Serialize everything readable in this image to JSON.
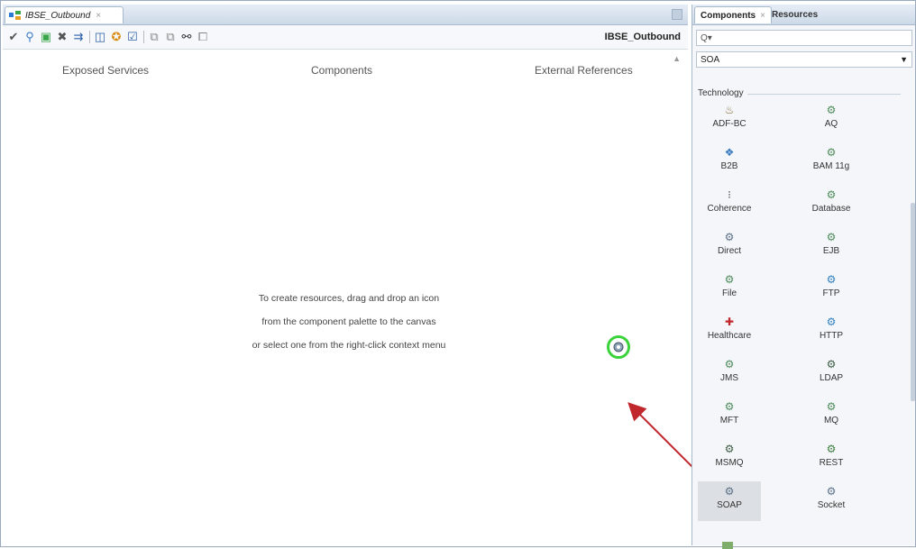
{
  "editor": {
    "tab_title": "IBSE_Outbound",
    "tab_close": "×",
    "composite_name": "IBSE_Outbound",
    "toolbar_icons": [
      "validate-icon",
      "wire-icon",
      "image-icon",
      "delete-icon",
      "deploy-icon",
      "test-icon",
      "bug-icon",
      "check-icon",
      "copy-icon",
      "paste-icon",
      "find-icon",
      "duplicate-icon"
    ]
  },
  "canvas": {
    "col_exposed": "Exposed Services",
    "col_components": "Components",
    "col_external": "External References",
    "hint_line1": "To create resources, drag and drop an icon",
    "hint_line2": "from the component palette to the canvas",
    "hint_line3": "or select one from the right-click context menu"
  },
  "palette": {
    "tab_components": "Components",
    "tab_resources": "Resources",
    "search_prefix": "Q▾",
    "category_selected": "SOA",
    "group_label": "Technology",
    "items": [
      {
        "label": "ADF-BC",
        "icon": "adf-bc-icon",
        "glyph": "♨"
      },
      {
        "label": "AQ",
        "icon": "aq-icon",
        "glyph": "⚙"
      },
      {
        "label": "B2B",
        "icon": "b2b-icon",
        "glyph": "❖"
      },
      {
        "label": "BAM 11g",
        "icon": "bam-icon",
        "glyph": "⚙"
      },
      {
        "label": "Coherence",
        "icon": "coherence-icon",
        "glyph": "⁝"
      },
      {
        "label": "Database",
        "icon": "database-icon",
        "glyph": "⚙"
      },
      {
        "label": "Direct",
        "icon": "direct-icon",
        "glyph": "⚙"
      },
      {
        "label": "EJB",
        "icon": "ejb-icon",
        "glyph": "⚙"
      },
      {
        "label": "File",
        "icon": "file-icon",
        "glyph": "⚙"
      },
      {
        "label": "FTP",
        "icon": "ftp-icon",
        "glyph": "⚙"
      },
      {
        "label": "Healthcare",
        "icon": "healthcare-icon",
        "glyph": "✚"
      },
      {
        "label": "HTTP",
        "icon": "http-icon",
        "glyph": "⚙"
      },
      {
        "label": "JMS",
        "icon": "jms-icon",
        "glyph": "⚙"
      },
      {
        "label": "LDAP",
        "icon": "ldap-icon",
        "glyph": "⚙"
      },
      {
        "label": "MFT",
        "icon": "mft-icon",
        "glyph": "⚙"
      },
      {
        "label": "MQ",
        "icon": "mq-icon",
        "glyph": "⚙"
      },
      {
        "label": "MSMQ",
        "icon": "msmq-icon",
        "glyph": "⚙"
      },
      {
        "label": "REST",
        "icon": "rest-icon",
        "glyph": "⚙"
      },
      {
        "label": "SOAP",
        "icon": "soap-icon",
        "glyph": "⚙"
      },
      {
        "label": "Socket",
        "icon": "socket-icon",
        "glyph": "⚙"
      }
    ]
  },
  "colors": {
    "drop_highlight": "#3ad33a",
    "arrow": "#c0282d",
    "selected_item": "#dcdfe3"
  }
}
